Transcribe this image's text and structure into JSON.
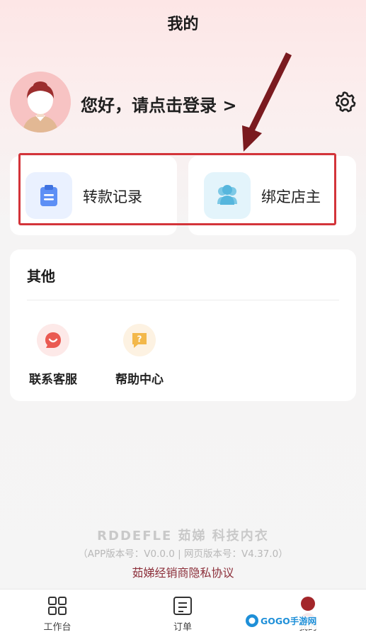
{
  "header": {
    "title": "我的"
  },
  "profile": {
    "login_prompt": "您好，请点击登录 >"
  },
  "quick_actions": [
    {
      "label": "转款记录",
      "icon": "clipboard-icon"
    },
    {
      "label": "绑定店主",
      "icon": "users-icon"
    }
  ],
  "other": {
    "title": "其他",
    "items": [
      {
        "label": "联系客服",
        "icon": "chat-smile-icon"
      },
      {
        "label": "帮助中心",
        "icon": "help-question-icon"
      }
    ]
  },
  "footer": {
    "brand": "RDDEFLE 茹娣 科技内衣",
    "version": "（APP版本号：V0.0.0 | 网页版本号：V4.37.0）",
    "privacy": "茹娣经销商隐私协议"
  },
  "tabbar": {
    "tabs": [
      {
        "label": "工作台",
        "icon": "grid-icon"
      },
      {
        "label": "订单",
        "icon": "order-list-icon"
      },
      {
        "label": "我的",
        "icon": "user-icon",
        "active": true
      }
    ]
  },
  "watermark": {
    "text": "GOGO手游网"
  },
  "colors": {
    "highlight": "#d3343a",
    "arrow": "#7a1a1f",
    "privacy_link": "#8c2f3a",
    "clipboard_icon_bg": "#eaf1ff",
    "users_icon_bg": "#e3f4fb"
  }
}
